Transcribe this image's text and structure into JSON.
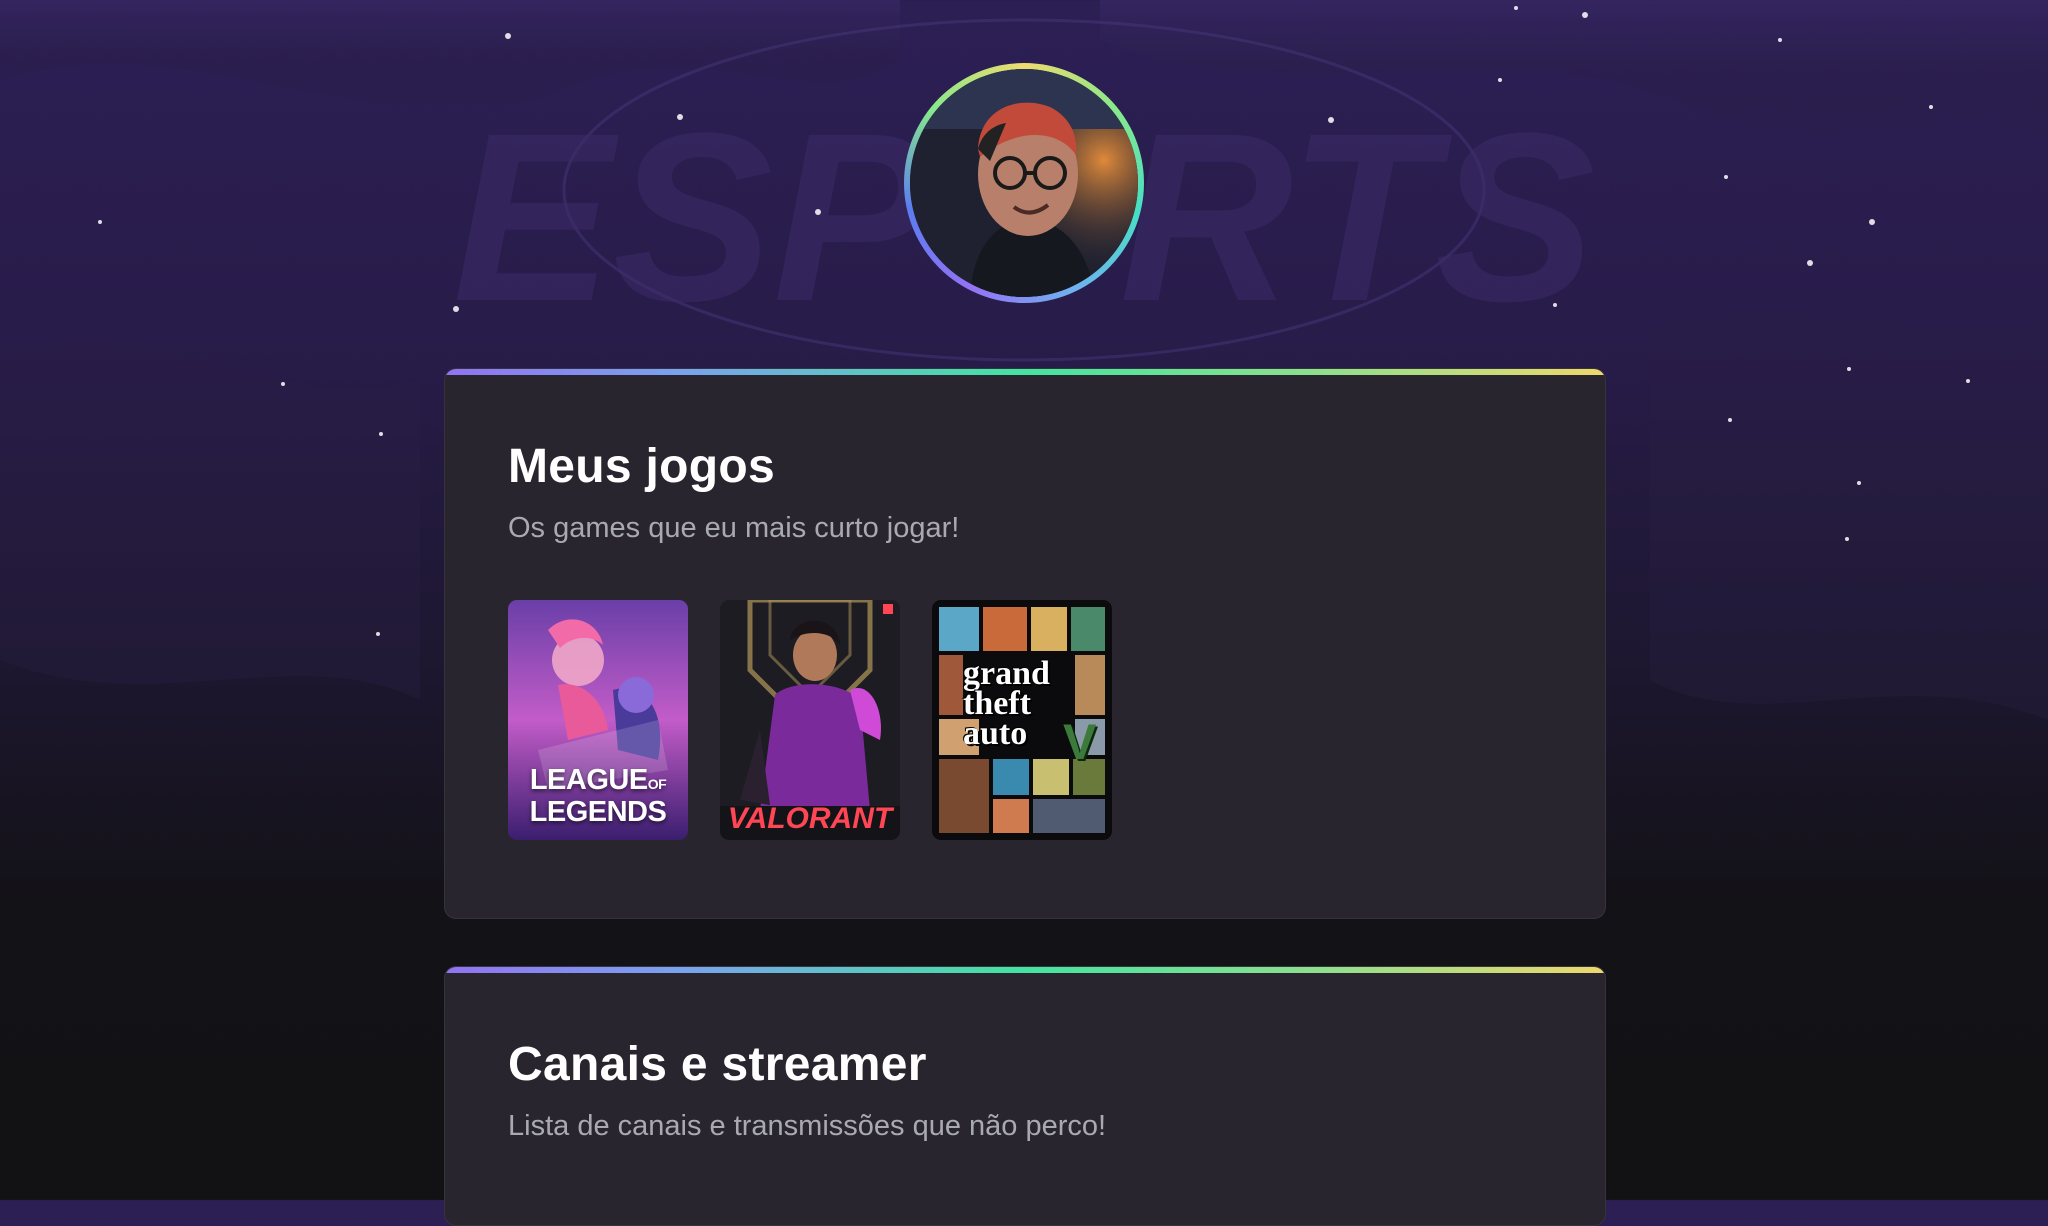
{
  "background": {
    "watermark_text": "ESPORTS"
  },
  "profile": {
    "avatar_alt": "Foto de perfil"
  },
  "games_section": {
    "title": "Meus jogos",
    "subtitle": "Os games que eu mais curto jogar!",
    "games": [
      {
        "name": "League of Legends",
        "logo_line1": "LEAGUE",
        "logo_of": "OF",
        "logo_line2": "LEGENDS"
      },
      {
        "name": "Valorant",
        "logo": "VALORANT"
      },
      {
        "name": "Grand Theft Auto V",
        "logo_line1": "grand",
        "logo_line2": "theft",
        "logo_line3": "auto",
        "logo_five": "V"
      }
    ]
  },
  "channels_section": {
    "title": "Canais e streamer",
    "subtitle": "Lista de canais e transmissões que não perco!"
  },
  "colors": {
    "accent_gradient": [
      "#9273f2",
      "#43e4a0",
      "#eed86d"
    ],
    "card_bg": "#29252f",
    "subtitle_text": "#a9a9b3",
    "valorant_red": "#ff4655"
  }
}
